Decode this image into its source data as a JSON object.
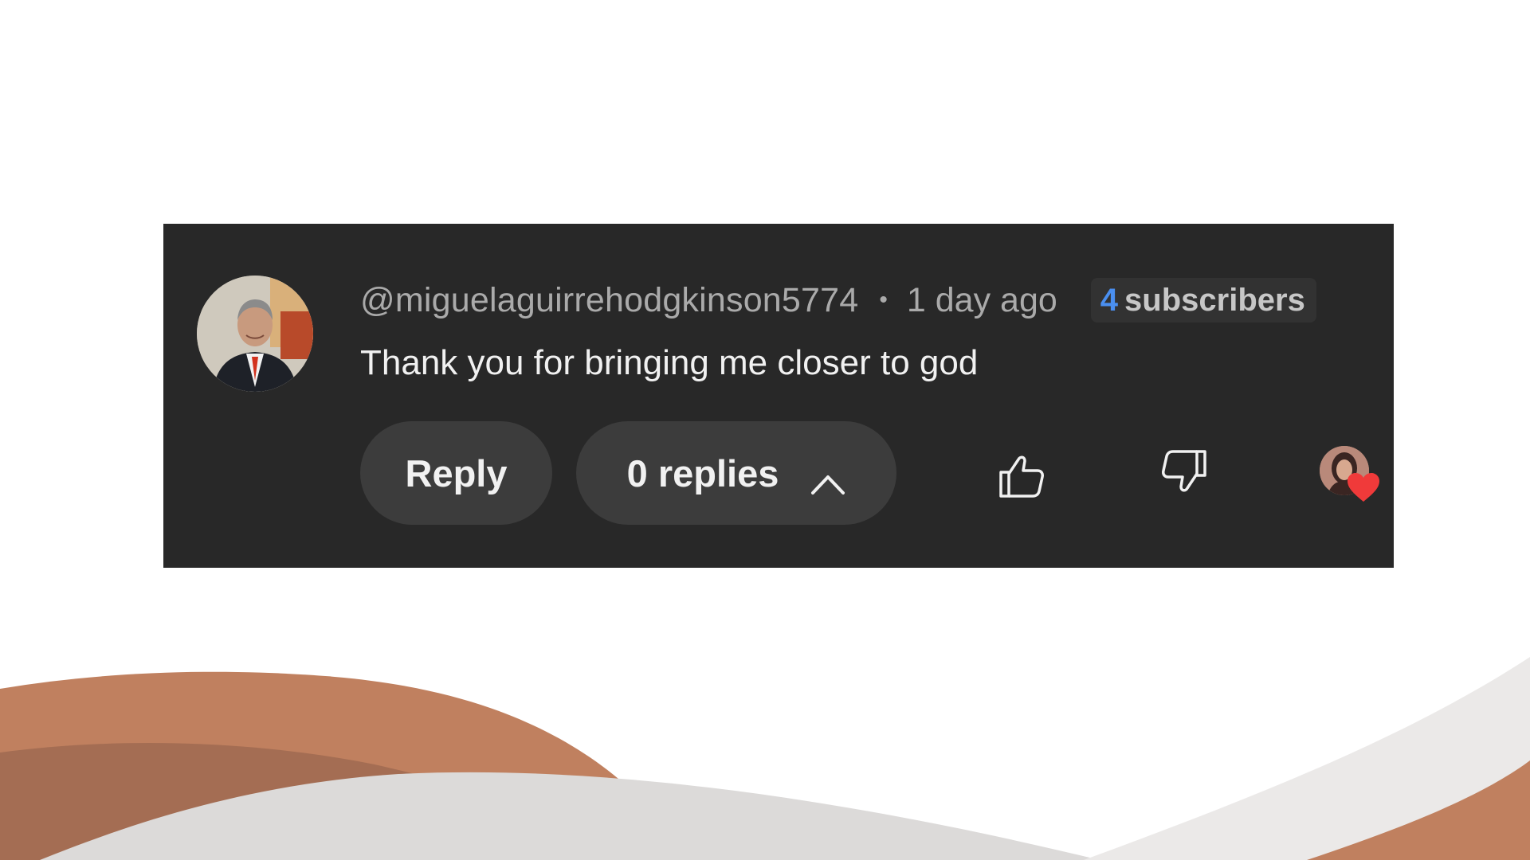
{
  "comment": {
    "author_handle": "@miguelaguirrehodgkinson5774",
    "separator": "•",
    "timestamp": "1 day ago",
    "subscriber_badge": {
      "count": "4",
      "label": "subscribers"
    },
    "text": "Thank you for bringing me closer to god",
    "actions": {
      "reply_label": "Reply",
      "replies_label": "0 replies"
    },
    "icons": {
      "like": "thumbs-up-icon",
      "dislike": "thumbs-down-icon",
      "replies_toggle": "chevron-up-icon",
      "creator_heart": "heart-icon"
    }
  },
  "colors": {
    "card_background": "#282828",
    "pill_background": "#3c3c3c",
    "subscriber_count": "#4a8ff0",
    "heart": "#f03a3a",
    "wave_dark": "#a46d53",
    "wave_orange": "#c0805f",
    "wave_gray": "#dcdad9"
  }
}
